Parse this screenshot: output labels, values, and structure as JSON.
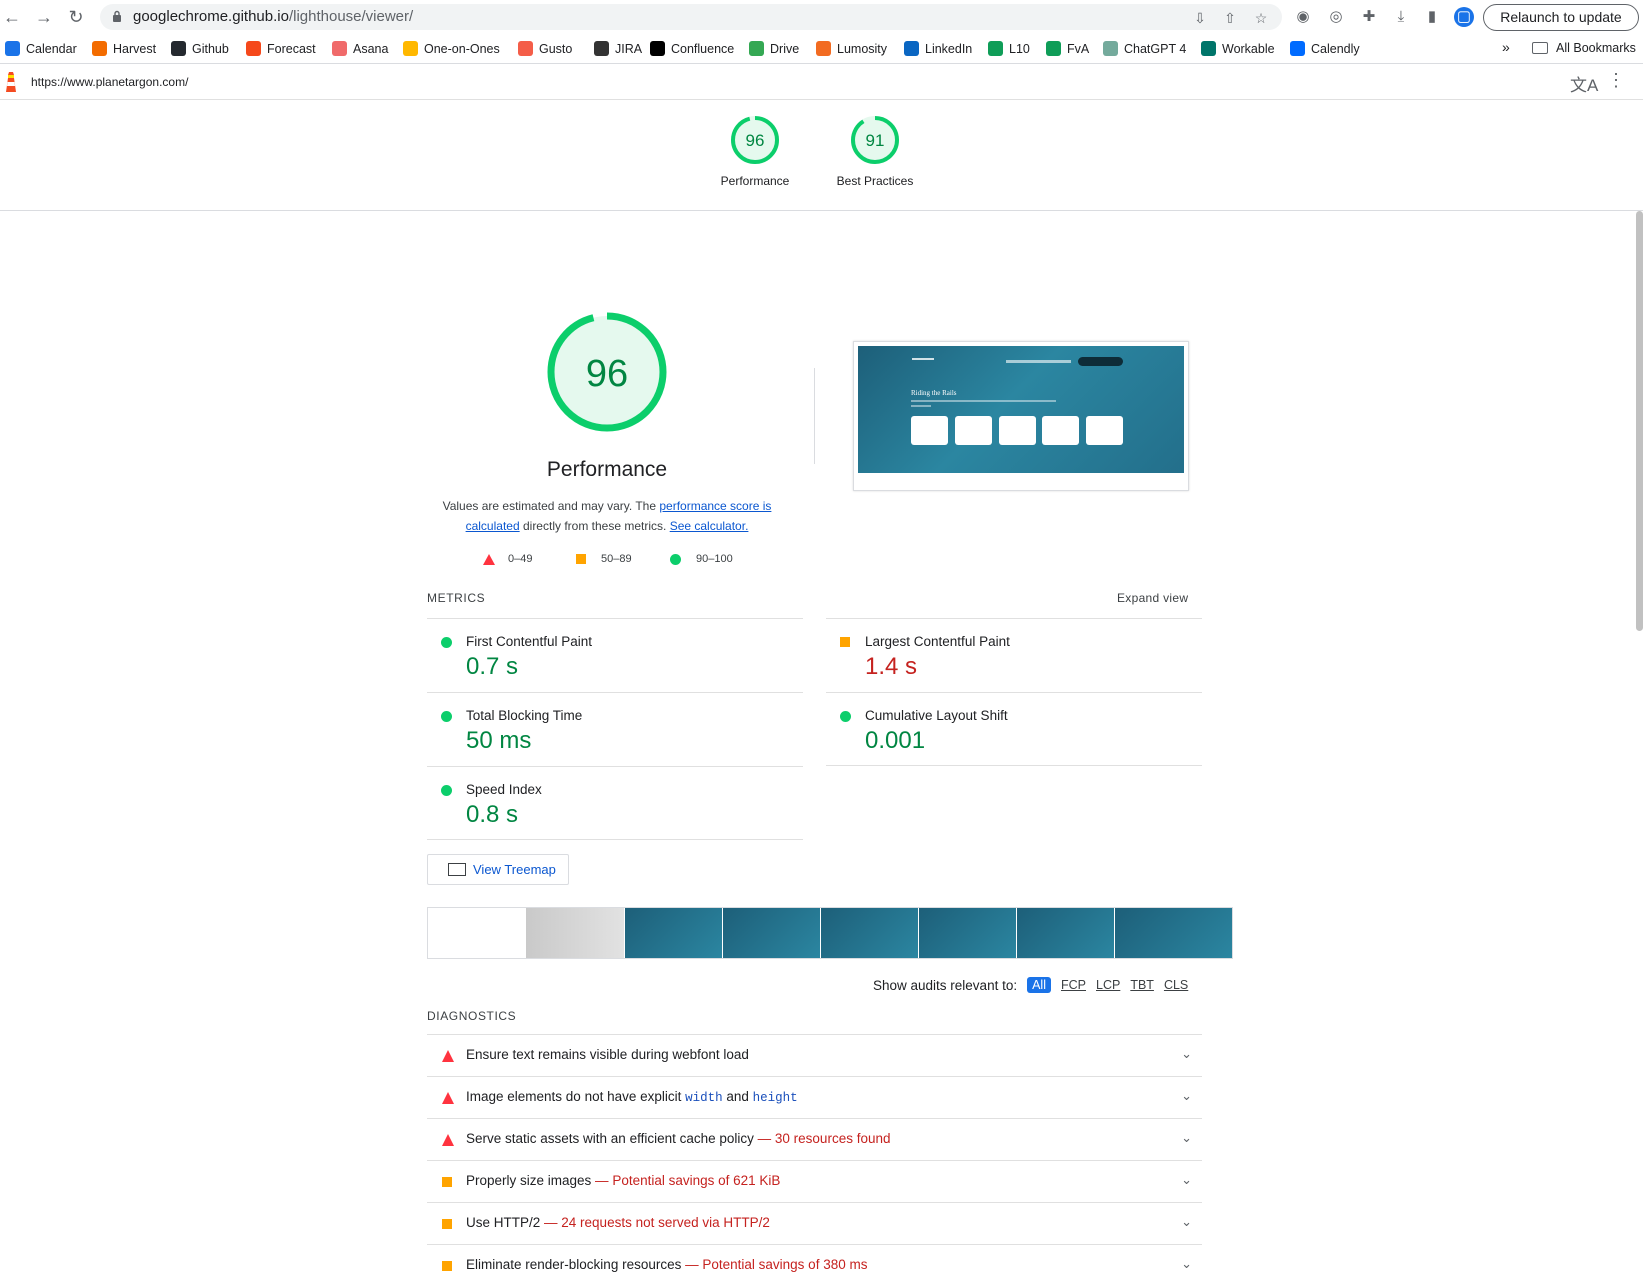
{
  "browser": {
    "url_host": "googlechrome.github.io",
    "url_path": "/lighthouse/viewer/",
    "relaunch_label": "Relaunch to update"
  },
  "bookmarks": [
    {
      "label": "Calendar",
      "icon": "calendar-icon",
      "color": "#1a73e8"
    },
    {
      "label": "Harvest",
      "icon": "harvest-icon",
      "color": "#f36c00"
    },
    {
      "label": "Github",
      "icon": "github-icon",
      "color": "#24292f"
    },
    {
      "label": "Forecast",
      "icon": "forecast-icon",
      "color": "#f5481b"
    },
    {
      "label": "Asana",
      "icon": "asana-icon",
      "color": "#f06a6a"
    },
    {
      "label": "One-on-Ones",
      "icon": "one-on-ones-icon",
      "color": "#ffb800"
    },
    {
      "label": "Gusto",
      "icon": "gusto-icon",
      "color": "#f45d48"
    },
    {
      "label": "JIRA",
      "icon": "jira-icon",
      "color": "#333333"
    },
    {
      "label": "Confluence",
      "icon": "confluence-icon",
      "color": "#000000"
    },
    {
      "label": "Drive",
      "icon": "drive-icon",
      "color": "#34a853"
    },
    {
      "label": "Lumosity",
      "icon": "lumosity-icon",
      "color": "#f26b21"
    },
    {
      "label": "LinkedIn",
      "icon": "linkedin-icon",
      "color": "#0a66c2"
    },
    {
      "label": "L10",
      "icon": "sheets-icon",
      "color": "#0f9d58"
    },
    {
      "label": "FvA",
      "icon": "sheets-icon",
      "color": "#0f9d58"
    },
    {
      "label": "ChatGPT 4",
      "icon": "chatgpt-icon",
      "color": "#74aa9c"
    },
    {
      "label": "Workable",
      "icon": "workable-icon",
      "color": "#00756a"
    },
    {
      "label": "Calendly",
      "icon": "calendly-icon",
      "color": "#006bff"
    }
  ],
  "bookmarks_more": "»",
  "bookmarks_all": "All Bookmarks",
  "lighthouse": {
    "tested_url": "https://www.planetargon.com/",
    "summary": [
      {
        "label": "Performance",
        "score": "96"
      },
      {
        "label": "Best Practices",
        "score": "91"
      }
    ],
    "gauge": {
      "score": "96",
      "title": "Performance",
      "desc_pre": "Values are estimated and may vary. The ",
      "desc_link1": "performance score is calculated",
      "desc_mid": " directly from these metrics. ",
      "desc_link2": "See calculator."
    },
    "screenshot": {
      "heading": "Riding the Rails"
    },
    "legend": {
      "fail": "0–49",
      "average": "50–89",
      "pass": "90–100"
    },
    "metrics_header": "METRICS",
    "expand_label": "Expand view",
    "metrics": [
      {
        "name": "First Contentful Paint",
        "value": "0.7 s",
        "rating": "pass"
      },
      {
        "name": "Largest Contentful Paint",
        "value": "1.4 s",
        "rating": "average"
      },
      {
        "name": "Total Blocking Time",
        "value": "50 ms",
        "rating": "pass"
      },
      {
        "name": "Cumulative Layout Shift",
        "value": "0.001",
        "rating": "pass"
      },
      {
        "name": "Speed Index",
        "value": "0.8 s",
        "rating": "pass"
      }
    ],
    "treemap_label": "View Treemap",
    "show_audits_label": "Show audits relevant to:",
    "filters": [
      "All",
      "FCP",
      "LCP",
      "TBT",
      "CLS"
    ],
    "diagnostics_header": "DIAGNOSTICS",
    "audits": [
      {
        "title": "Ensure text remains visible during webfont load",
        "display": "",
        "rating": "fail"
      },
      {
        "title_pre": "Image elements do not have explicit ",
        "code1": "width",
        "title_mid": " and ",
        "code2": "height",
        "display": "",
        "rating": "fail"
      },
      {
        "title": "Serve static assets with an efficient cache policy",
        "display": "30 resources found",
        "rating": "fail"
      },
      {
        "title": "Properly size images",
        "display": "Potential savings of 621 KiB",
        "rating": "average"
      },
      {
        "title": "Use HTTP/2",
        "display": "24 requests not served via HTTP/2",
        "rating": "average"
      },
      {
        "title": "Eliminate render-blocking resources",
        "display": "Potential savings of 380 ms",
        "rating": "average"
      }
    ],
    "colors": {
      "pass": "#0cce6b",
      "pass_text": "#018642",
      "average": "#ffa400",
      "fail": "#ff4e42",
      "fail_text": "#c5221f"
    }
  }
}
